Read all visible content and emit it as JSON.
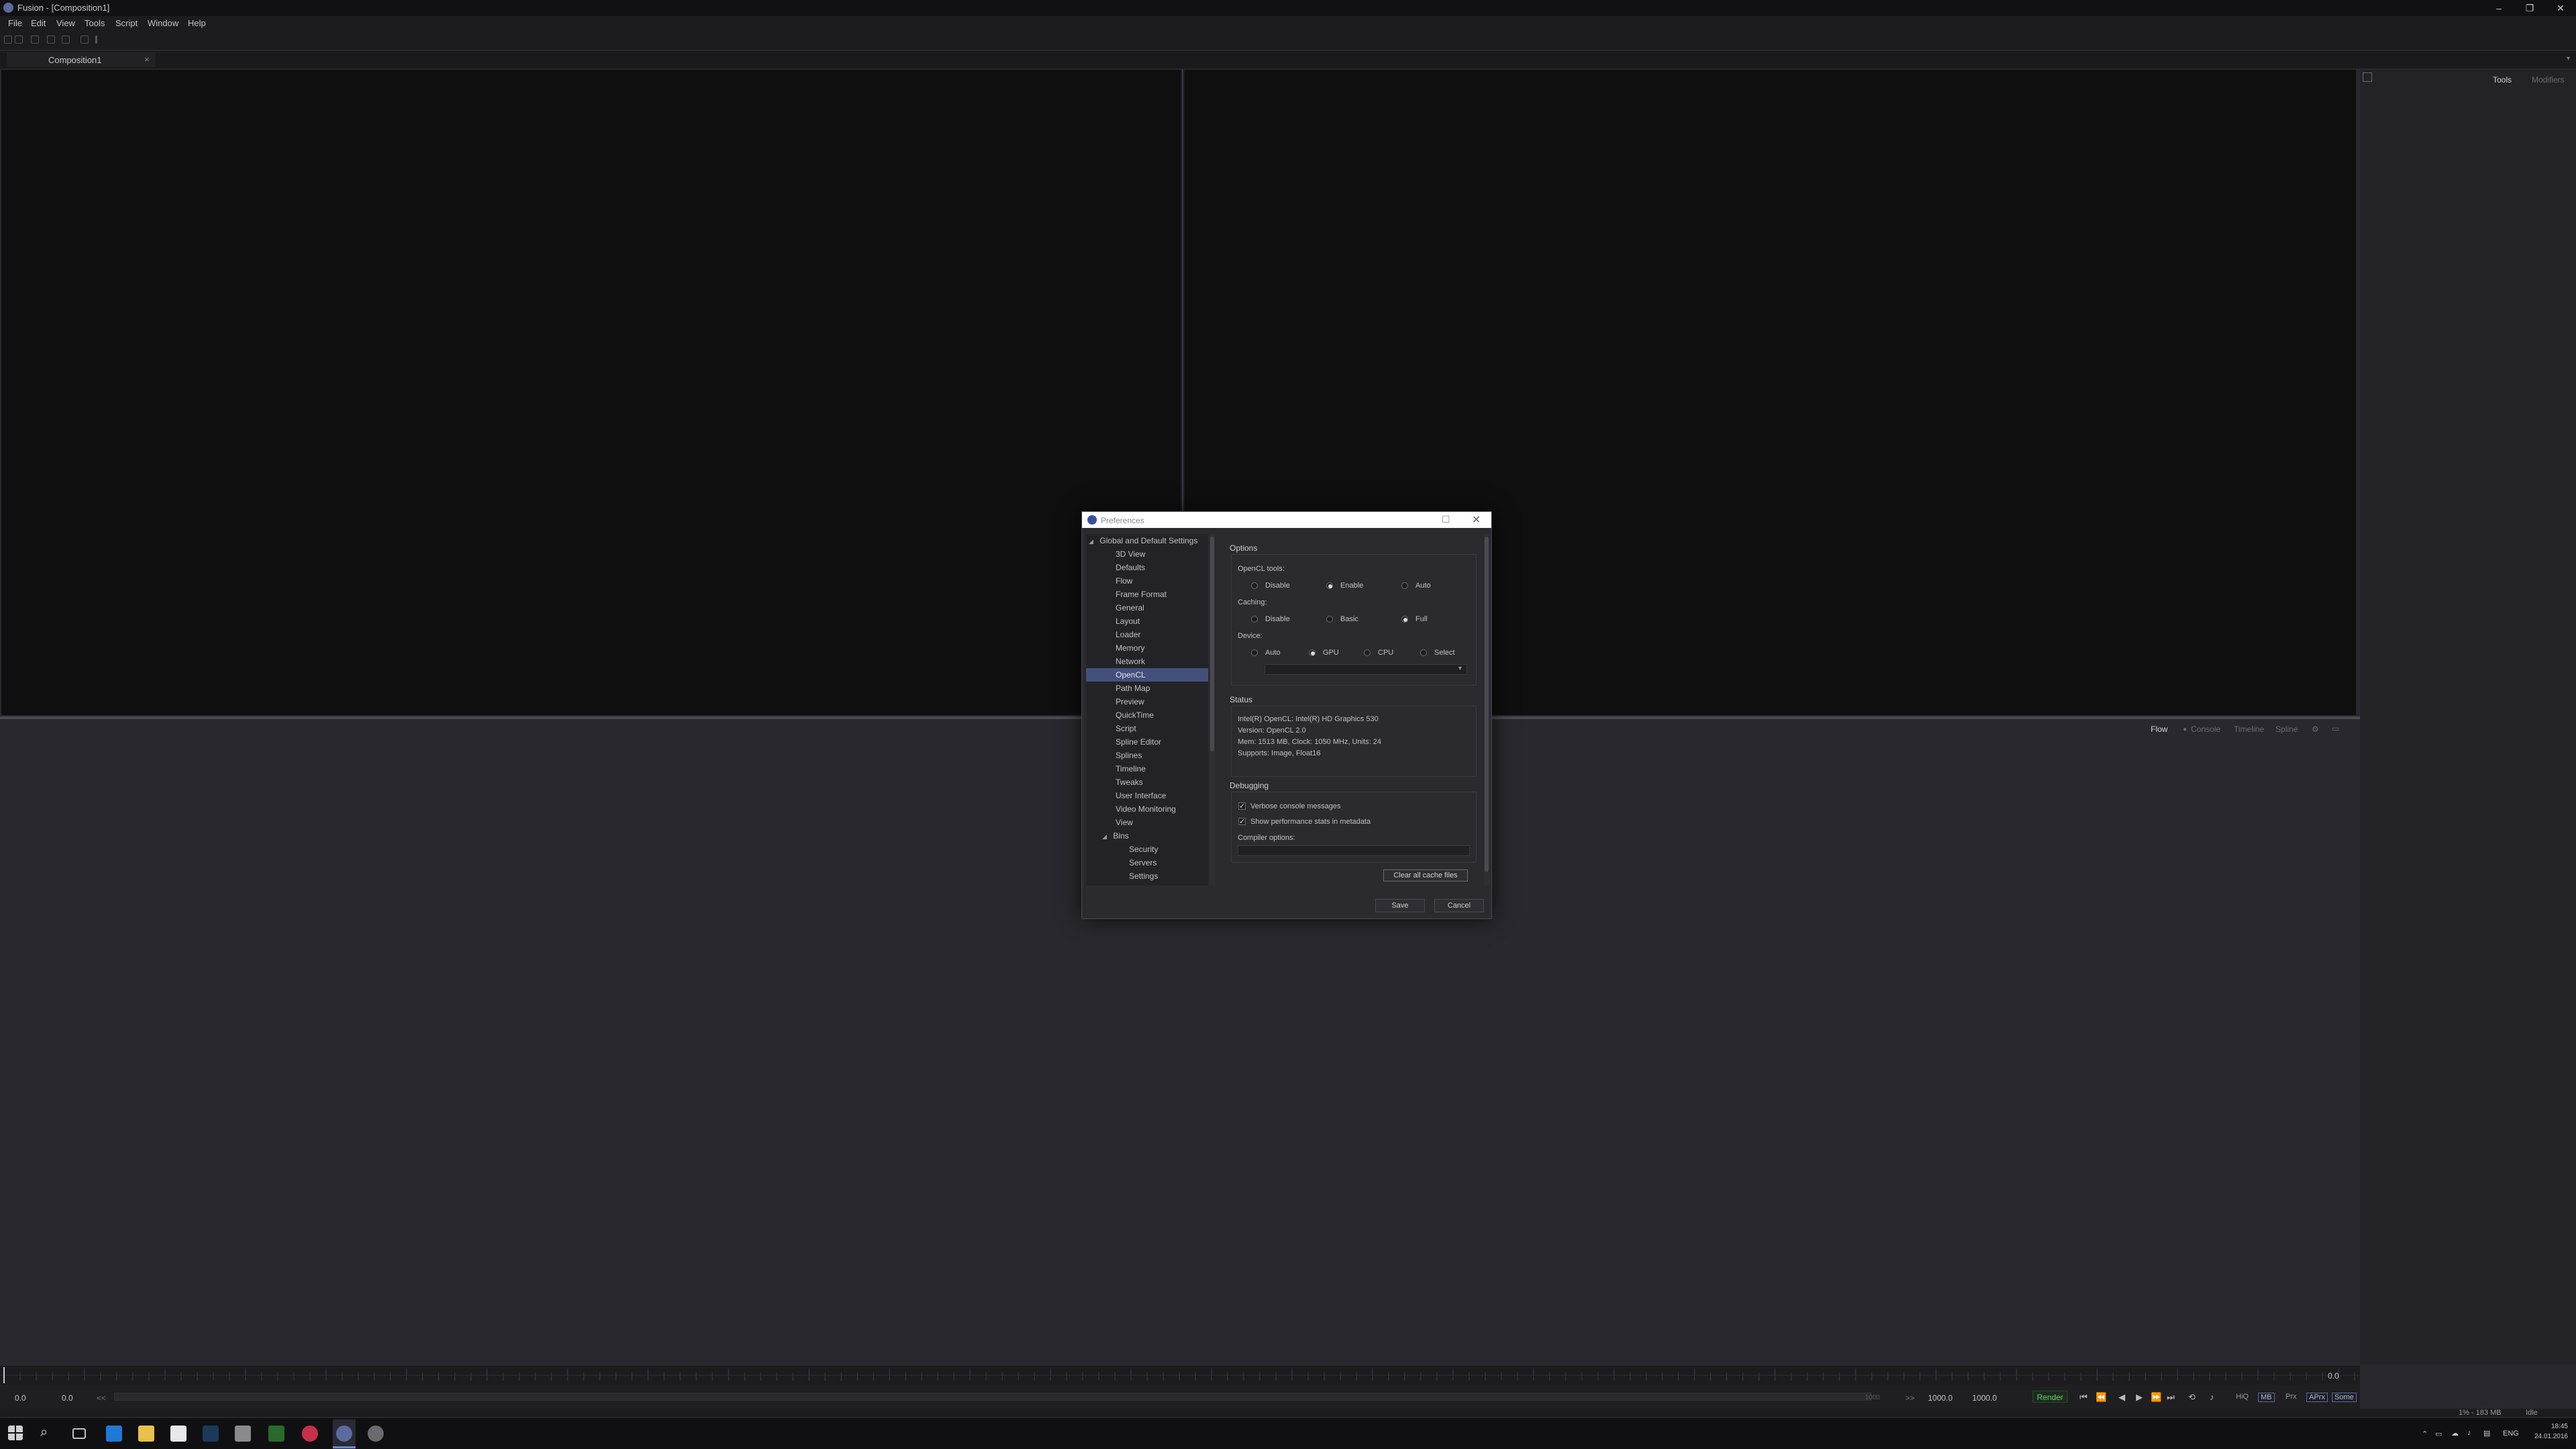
{
  "window": {
    "title": "Fusion - [Composition1]",
    "controls": [
      "–",
      "❐",
      "✕"
    ]
  },
  "menu": [
    "File",
    "Edit",
    "View",
    "Tools",
    "Script",
    "Window",
    "Help"
  ],
  "tabs": [
    {
      "label": "Composition1",
      "close": "×"
    }
  ],
  "right_panel": {
    "tabs": [
      "Tools",
      "Modifiers"
    ]
  },
  "lower_panel": {
    "tabs": [
      "Flow",
      "Console",
      "Timeline",
      "Spline"
    ]
  },
  "timebar": {
    "start_time": "0.0",
    "current_start": "0.0",
    "rewind": "<<",
    "ffwd": ">>",
    "render_end": "1000.0",
    "global_end": "1000.0",
    "ruler_end_value": "0.0",
    "range_end_label": "1000",
    "render_label": "Render",
    "mode_buttons": [
      "HiQ",
      "MB",
      "Prx",
      "APrx",
      "Some"
    ]
  },
  "status": {
    "memory": "1% - 183 MB",
    "state": "Idle"
  },
  "taskbar": {
    "lang": "ENG",
    "time": "18:45",
    "date": "24.01.2016"
  },
  "dialog": {
    "title": "Preferences",
    "tree": {
      "root": "Global and Default Settings",
      "items": [
        "3D View",
        "Defaults",
        "Flow",
        "Frame Format",
        "General",
        "Layout",
        "Loader",
        "Memory",
        "Network",
        "OpenCL",
        "Path Map",
        "Preview",
        "QuickTime",
        "Script",
        "Spline Editor",
        "Splines",
        "Timeline",
        "Tweaks",
        "User Interface",
        "Video Monitoring",
        "View"
      ],
      "selected": "OpenCL",
      "bins": {
        "label": "Bins",
        "items": [
          "Security",
          "Servers",
          "Settings"
        ]
      }
    },
    "options": {
      "header": "Options",
      "opencl_tools": {
        "label": "OpenCL tools:",
        "choices": [
          "Disable",
          "Enable",
          "Auto"
        ],
        "selected": "Enable"
      },
      "caching": {
        "label": "Caching:",
        "choices": [
          "Disable",
          "Basic",
          "Full"
        ],
        "selected": "Full"
      },
      "device": {
        "label": "Device:",
        "choices": [
          "Auto",
          "GPU",
          "CPU",
          "Select"
        ],
        "selected": "GPU"
      }
    },
    "status": {
      "header": "Status",
      "lines": [
        "Intel(R) OpenCL: Intel(R) HD Graphics 530",
        "Version: OpenCL 2.0",
        "Mem: 1513 MB, Clock: 1050 MHz, Units: 24",
        "Supports: Image, Float16"
      ]
    },
    "debugging": {
      "header": "Debugging",
      "verbose": "Verbose console messages",
      "perf_stats": "Show performance stats in metadata",
      "compiler_label": "Compiler options:"
    },
    "buttons": {
      "clear_cache": "Clear all cache files",
      "save": "Save",
      "cancel": "Cancel"
    }
  }
}
